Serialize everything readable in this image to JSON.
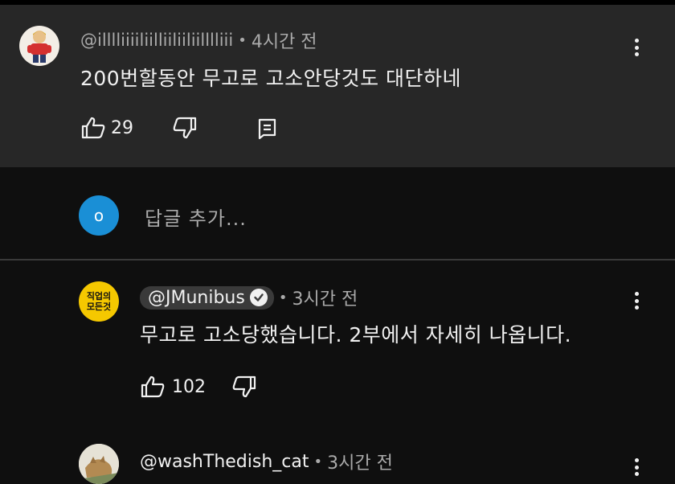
{
  "comment": {
    "handle": "@illlliiiiliilliiliiliilllliii",
    "time": "4시간 전",
    "text": "200번할동안 무고로 고소안당것도 대단하네",
    "like_count": "29"
  },
  "reply_input": {
    "avatar_letter": "o",
    "placeholder": "답글 추가..."
  },
  "replies": [
    {
      "avatar_text_line1": "직업의",
      "avatar_text_line2": "모든것",
      "handle": "@JMunibus",
      "verified": true,
      "time": "3시간 전",
      "text": "무고로 고소당했습니다. 2부에서 자세히 나옵니다.",
      "like_count": "102"
    },
    {
      "handle": "@washThedish_cat",
      "time": "3시간 전"
    }
  ],
  "icons": {
    "like": "thumbs-up-icon",
    "dislike": "thumbs-down-icon",
    "reply": "reply-icon",
    "more": "more-vert-icon",
    "verified": "verified-check-icon"
  },
  "colors": {
    "background": "#0f0f0f",
    "comment_highlight": "#272727",
    "reply_avatar": "#1a8fd6",
    "channel_avatar": "#f5c800",
    "secondary_text": "#aaaaaa"
  }
}
